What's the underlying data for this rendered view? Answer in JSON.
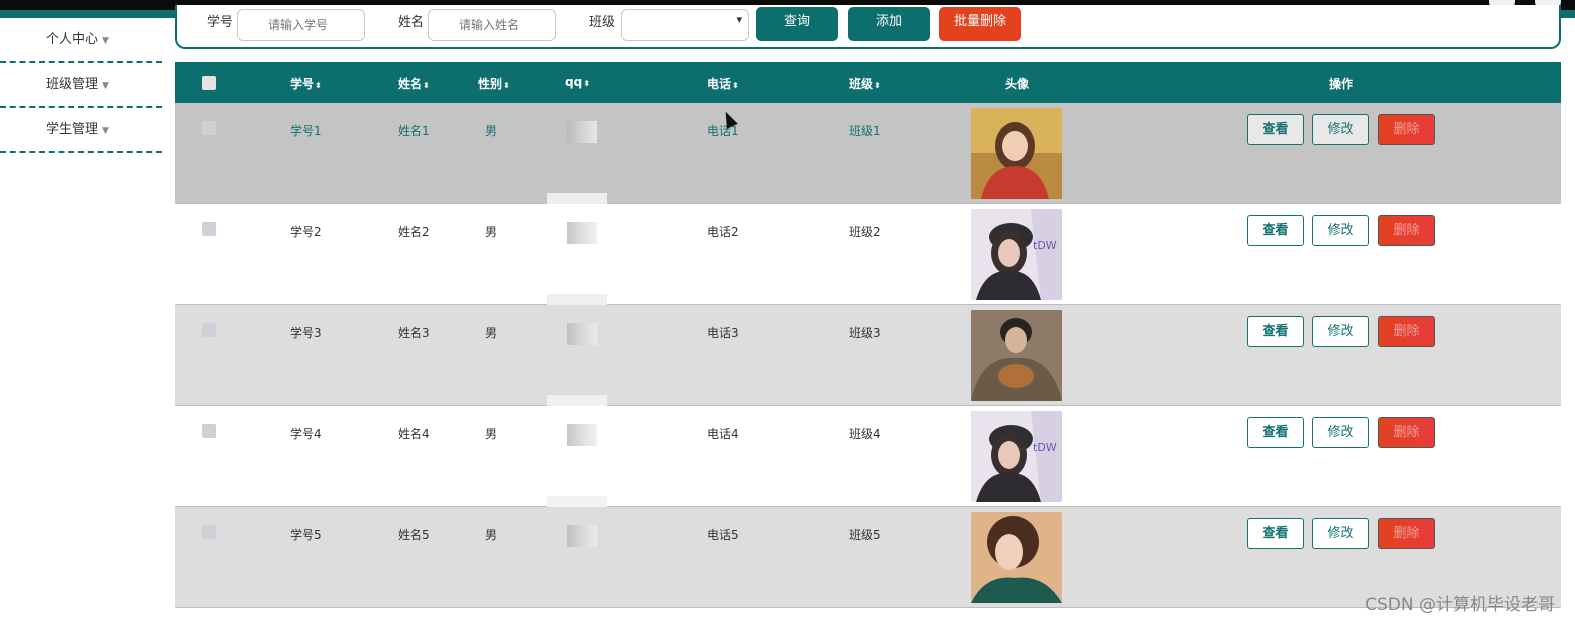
{
  "sidebar": {
    "items": [
      {
        "label": "个人中心"
      },
      {
        "label": "班级管理"
      },
      {
        "label": "学生管理"
      }
    ]
  },
  "search": {
    "student_no_label": "学号",
    "student_no_placeholder": "请输入学号",
    "name_label": "姓名",
    "name_placeholder": "请输入姓名",
    "class_label": "班级",
    "class_value": "",
    "query_label": "查询",
    "add_label": "添加",
    "batch_delete_label": "批量删除"
  },
  "table": {
    "headers": {
      "student_no": "学号",
      "name": "姓名",
      "gender": "性别",
      "qq": "qq",
      "phone": "电话",
      "class": "班级",
      "avatar": "头像",
      "actions": "操作"
    },
    "rows": [
      {
        "student_no": "学号1",
        "name": "姓名1",
        "gender": "男",
        "phone": "电话1",
        "class": "班级1"
      },
      {
        "student_no": "学号2",
        "name": "姓名2",
        "gender": "男",
        "phone": "电话2",
        "class": "班级2"
      },
      {
        "student_no": "学号3",
        "name": "姓名3",
        "gender": "男",
        "phone": "电话3",
        "class": "班级3"
      },
      {
        "student_no": "学号4",
        "name": "姓名4",
        "gender": "男",
        "phone": "电话4",
        "class": "班级4"
      },
      {
        "student_no": "学号5",
        "name": "姓名5",
        "gender": "男",
        "phone": "电话5",
        "class": "班级5"
      }
    ],
    "actions": {
      "view": "查看",
      "edit": "修改",
      "delete": "删除"
    }
  },
  "watermark": "CSDN @计算机毕设老哥",
  "colors": {
    "primary": "#0d6e6e",
    "danger": "#e2421e"
  }
}
